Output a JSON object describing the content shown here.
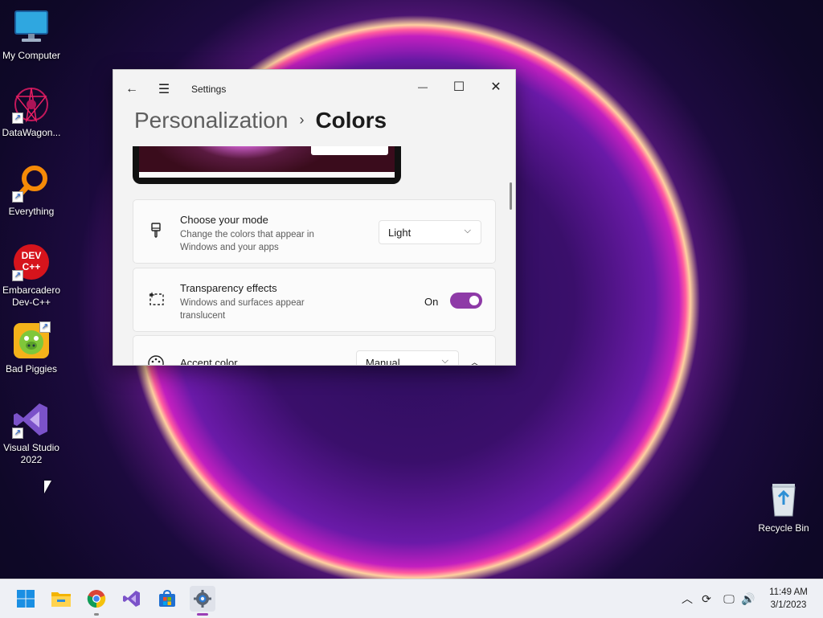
{
  "desktop": {
    "icons": [
      {
        "label": "My Computer",
        "icon": "monitor-icon"
      },
      {
        "label": "DataWagon...",
        "icon": "datawagon-icon"
      },
      {
        "label": "Everything",
        "icon": "magnifier-icon"
      },
      {
        "label": "Embarcadero Dev-C++",
        "icon": "devcpp-icon",
        "badge": "DEV C++"
      },
      {
        "label": "Bad Piggies",
        "icon": "bad-piggies-icon"
      },
      {
        "label": "Visual Studio 2022",
        "icon": "visual-studio-icon"
      },
      {
        "label": "Recycle Bin",
        "icon": "recycle-bin-icon"
      }
    ]
  },
  "settings_window": {
    "app_title": "Settings",
    "breadcrumb": {
      "parent": "Personalization",
      "separator": "›",
      "current": "Colors"
    },
    "window_buttons": {
      "minimize": "—",
      "maximize": "☐",
      "close": "✕"
    },
    "mode": {
      "title": "Choose your mode",
      "description": "Change the colors that appear in Windows and your apps",
      "value": "Light"
    },
    "transparency": {
      "title": "Transparency effects",
      "description": "Windows and surfaces appear translucent",
      "state_label": "On",
      "enabled": true
    },
    "accent": {
      "title": "Accent color",
      "value": "Manual"
    },
    "accent_color": "#8e3aa7"
  },
  "taskbar": {
    "apps": [
      "start-icon",
      "file-explorer-icon",
      "chrome-icon",
      "visual-studio-icon",
      "store-icon",
      "settings-icon"
    ],
    "clock": {
      "time": "11:49 AM",
      "date": "3/1/2023"
    }
  }
}
